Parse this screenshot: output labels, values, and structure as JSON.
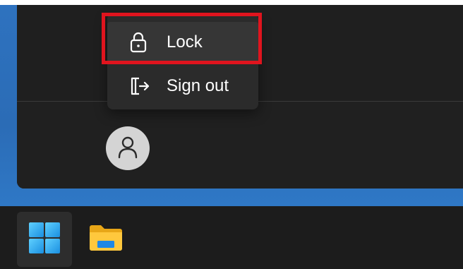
{
  "top_strip": {
    "fragment_text": ""
  },
  "power_menu": {
    "items": [
      {
        "id": "lock",
        "label": "Lock",
        "icon": "lock-icon"
      },
      {
        "id": "signout",
        "label": "Sign out",
        "icon": "sign-out-icon"
      }
    ],
    "highlight_color": "#e0141e"
  },
  "user": {
    "avatar_icon": "person-icon"
  },
  "taskbar": {
    "items": [
      {
        "id": "start",
        "icon": "windows-logo-icon"
      },
      {
        "id": "file-explorer",
        "icon": "folder-icon"
      }
    ]
  },
  "colors": {
    "desktop_blue": "#2b6cb6",
    "panel_bg": "#1f1f1f",
    "menu_bg": "#2b2b2b",
    "taskbar_bg": "#1c1c1c"
  }
}
